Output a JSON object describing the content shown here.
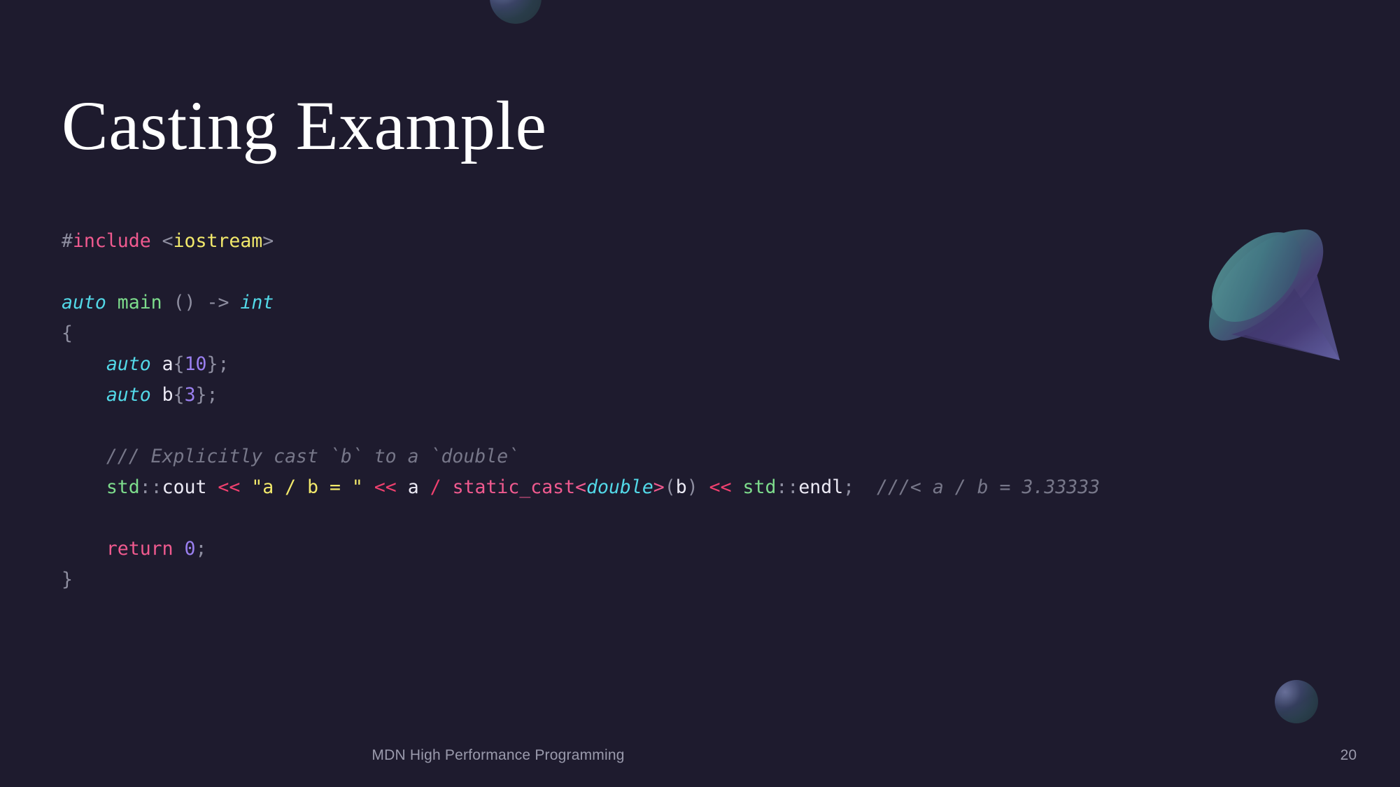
{
  "slide": {
    "title": "Casting Example",
    "background_color": "#1e1b2e",
    "footer_text": "MDN High Performance Programming",
    "page_number": "20"
  },
  "code": {
    "language": "cpp",
    "lines": [
      {
        "tokens": [
          {
            "t": "#",
            "c": "punct"
          },
          {
            "t": "include",
            "c": "pre"
          },
          {
            "t": " ",
            "c": "plain"
          },
          {
            "t": "<",
            "c": "punct"
          },
          {
            "t": "iostream",
            "c": "header"
          },
          {
            "t": ">",
            "c": "punct"
          }
        ]
      },
      {
        "tokens": []
      },
      {
        "tokens": [
          {
            "t": "auto",
            "c": "type"
          },
          {
            "t": " ",
            "c": "plain"
          },
          {
            "t": "main",
            "c": "fn"
          },
          {
            "t": " ",
            "c": "plain"
          },
          {
            "t": "()",
            "c": "punct"
          },
          {
            "t": " ",
            "c": "plain"
          },
          {
            "t": "->",
            "c": "punct"
          },
          {
            "t": " ",
            "c": "plain"
          },
          {
            "t": "int",
            "c": "type"
          }
        ]
      },
      {
        "tokens": [
          {
            "t": "{",
            "c": "punct"
          }
        ]
      },
      {
        "tokens": [
          {
            "t": "    ",
            "c": "plain"
          },
          {
            "t": "auto",
            "c": "type"
          },
          {
            "t": " ",
            "c": "plain"
          },
          {
            "t": "a",
            "c": "var"
          },
          {
            "t": "{",
            "c": "punct"
          },
          {
            "t": "10",
            "c": "num"
          },
          {
            "t": "};",
            "c": "punct"
          }
        ]
      },
      {
        "tokens": [
          {
            "t": "    ",
            "c": "plain"
          },
          {
            "t": "auto",
            "c": "type"
          },
          {
            "t": " ",
            "c": "plain"
          },
          {
            "t": "b",
            "c": "var"
          },
          {
            "t": "{",
            "c": "punct"
          },
          {
            "t": "3",
            "c": "num"
          },
          {
            "t": "};",
            "c": "punct"
          }
        ]
      },
      {
        "tokens": []
      },
      {
        "tokens": [
          {
            "t": "    ",
            "c": "plain"
          },
          {
            "t": "/// Explicitly cast `b` to a `double`",
            "c": "comment"
          }
        ]
      },
      {
        "tokens": [
          {
            "t": "    ",
            "c": "plain"
          },
          {
            "t": "std",
            "c": "ns"
          },
          {
            "t": "::",
            "c": "punct"
          },
          {
            "t": "cout",
            "c": "var"
          },
          {
            "t": " ",
            "c": "plain"
          },
          {
            "t": "<<",
            "c": "op"
          },
          {
            "t": " ",
            "c": "plain"
          },
          {
            "t": "\"a / b = \"",
            "c": "str"
          },
          {
            "t": " ",
            "c": "plain"
          },
          {
            "t": "<<",
            "c": "op"
          },
          {
            "t": " ",
            "c": "plain"
          },
          {
            "t": "a",
            "c": "var"
          },
          {
            "t": " ",
            "c": "plain"
          },
          {
            "t": "/",
            "c": "op"
          },
          {
            "t": " ",
            "c": "plain"
          },
          {
            "t": "static_cast",
            "c": "cast"
          },
          {
            "t": "<",
            "c": "cast"
          },
          {
            "t": "double",
            "c": "type"
          },
          {
            "t": ">",
            "c": "cast"
          },
          {
            "t": "(",
            "c": "punct"
          },
          {
            "t": "b",
            "c": "var"
          },
          {
            "t": ")",
            "c": "punct"
          },
          {
            "t": " ",
            "c": "plain"
          },
          {
            "t": "<<",
            "c": "op"
          },
          {
            "t": " ",
            "c": "plain"
          },
          {
            "t": "std",
            "c": "ns"
          },
          {
            "t": "::",
            "c": "punct"
          },
          {
            "t": "endl",
            "c": "var"
          },
          {
            "t": ";",
            "c": "punct"
          },
          {
            "t": "  ",
            "c": "plain"
          },
          {
            "t": "///< a / b = 3.33333",
            "c": "comment"
          }
        ]
      },
      {
        "tokens": []
      },
      {
        "tokens": [
          {
            "t": "    ",
            "c": "plain"
          },
          {
            "t": "return",
            "c": "kw"
          },
          {
            "t": " ",
            "c": "plain"
          },
          {
            "t": "0",
            "c": "num"
          },
          {
            "t": ";",
            "c": "punct"
          }
        ]
      },
      {
        "tokens": [
          {
            "t": "}",
            "c": "punct"
          }
        ]
      }
    ]
  },
  "decorations": {
    "cone": {
      "name": "cone-shape",
      "gradient_from": "#4a8f92",
      "gradient_to": "#4b3d7a"
    },
    "sphere_top": {
      "name": "sphere-shape-top"
    },
    "sphere_bottom": {
      "name": "sphere-shape-bottom"
    }
  }
}
